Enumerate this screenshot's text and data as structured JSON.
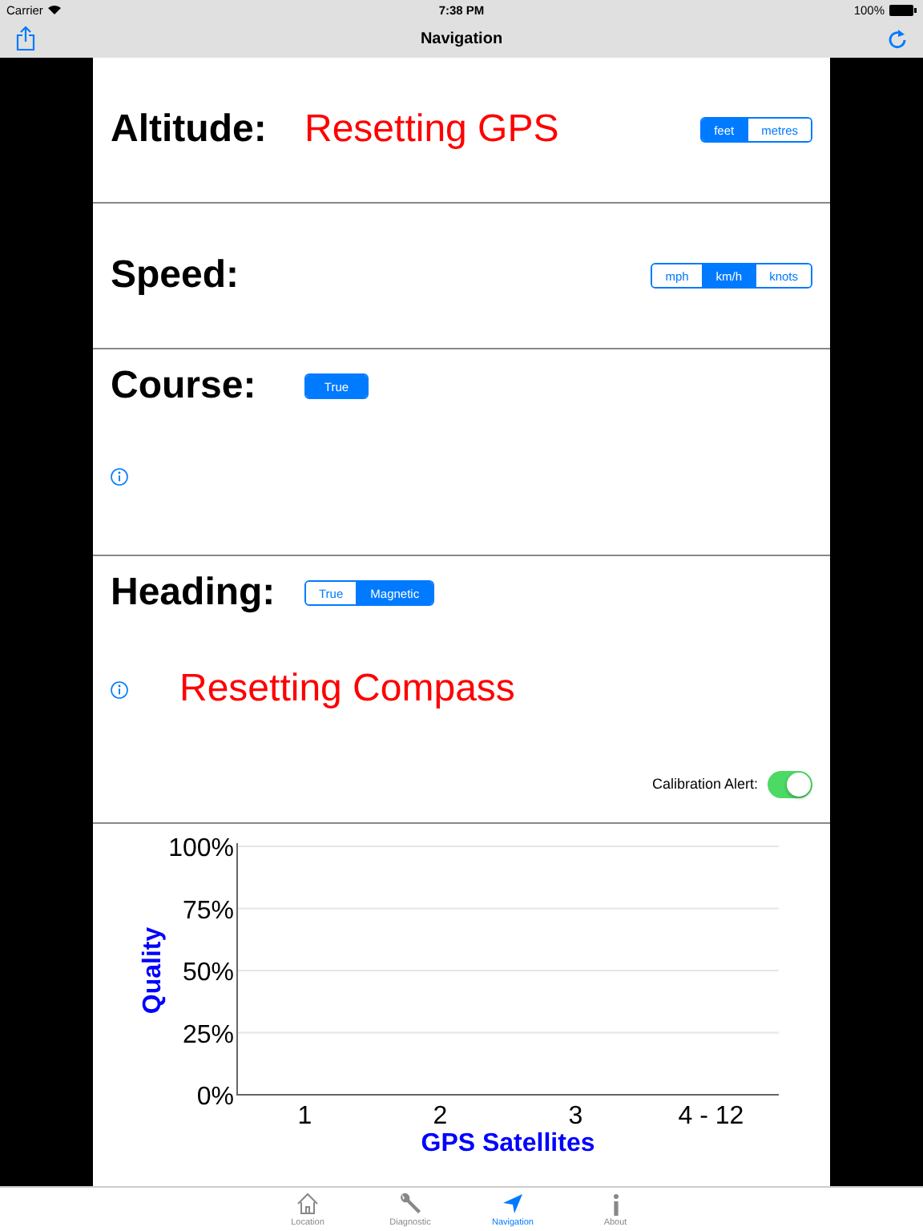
{
  "status_bar": {
    "carrier": "Carrier",
    "time": "7:38 PM",
    "battery": "100%"
  },
  "nav_bar": {
    "title": "Navigation"
  },
  "sections": [
    {
      "kind": "inline",
      "label": "Altitude:",
      "message": "Resetting GPS",
      "segments": [
        {
          "label": "feet",
          "selected": true
        },
        {
          "label": "metres",
          "selected": false
        }
      ]
    },
    {
      "kind": "inline",
      "label": "Speed:",
      "segments": [
        {
          "label": "mph",
          "selected": false
        },
        {
          "label": "km/h",
          "selected": true
        },
        {
          "label": "knots",
          "selected": false
        }
      ]
    },
    {
      "kind": "stacked",
      "label": "Course:",
      "info": true,
      "segments": [
        {
          "label": "True",
          "selected": true
        }
      ]
    },
    {
      "kind": "stacked",
      "label": "Heading:",
      "info": true,
      "message": "Resetting Compass",
      "segments": [
        {
          "label": "True",
          "selected": false
        },
        {
          "label": "Magnetic",
          "selected": true
        }
      ],
      "toggle": {
        "label": "Calibration Alert:",
        "on": true
      }
    }
  ],
  "chart": {
    "chart_data": {
      "type": "bar",
      "xlabel": "GPS Satellites",
      "ylabel": "Quality",
      "categories": [
        "1",
        "2",
        "3",
        "4 - 12"
      ],
      "values": [
        null,
        null,
        null,
        null
      ],
      "grid": true,
      "ylim": [
        0,
        100
      ],
      "yticks": [
        {
          "value": 0,
          "label": "0%"
        },
        {
          "value": 25,
          "label": "25%"
        },
        {
          "value": 50,
          "label": "50%"
        },
        {
          "value": 75,
          "label": "75%"
        },
        {
          "value": 100,
          "label": "100%"
        }
      ]
    }
  },
  "tab_bar": {
    "items": [
      {
        "kind": "house",
        "label": "Location",
        "selected": false
      },
      {
        "kind": "wrench",
        "label": "Diagnostic",
        "selected": false
      },
      {
        "kind": "arrow",
        "label": "Navigation",
        "selected": true
      },
      {
        "kind": "info",
        "label": "About",
        "selected": false
      }
    ]
  }
}
